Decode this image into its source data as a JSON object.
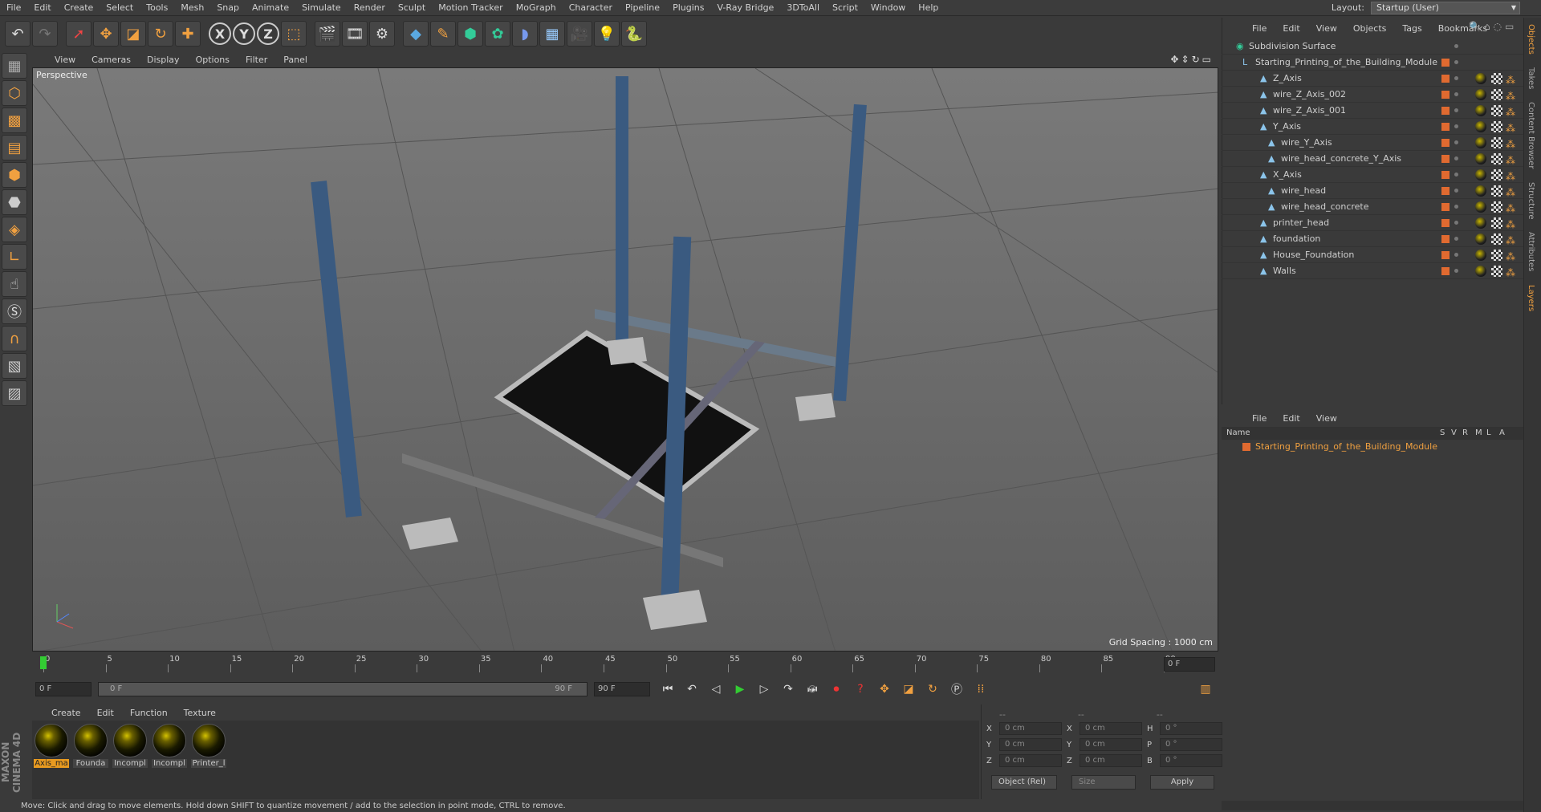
{
  "menubar": [
    "File",
    "Edit",
    "Create",
    "Select",
    "Tools",
    "Mesh",
    "Snap",
    "Animate",
    "Simulate",
    "Render",
    "Sculpt",
    "Motion Tracker",
    "MoGraph",
    "Character",
    "Pipeline",
    "Plugins",
    "V-Ray Bridge",
    "3DToAll",
    "Script",
    "Window",
    "Help"
  ],
  "layout": {
    "label": "Layout:",
    "value": "Startup (User)"
  },
  "viewport": {
    "menu": [
      "View",
      "Cameras",
      "Display",
      "Options",
      "Filter",
      "Panel"
    ],
    "label": "Perspective",
    "grid_spacing": "Grid Spacing : 1000 cm"
  },
  "timeline": {
    "ticks": [
      "0",
      "5",
      "10",
      "15",
      "20",
      "25",
      "30",
      "35",
      "40",
      "45",
      "50",
      "55",
      "60",
      "65",
      "70",
      "75",
      "80",
      "85",
      "90"
    ],
    "end_field": "0 F"
  },
  "time_controls": {
    "start": "0 F",
    "range_start": "0 F",
    "range_end": "90 F",
    "end": "90 F"
  },
  "materials": {
    "menu": [
      "Create",
      "Edit",
      "Function",
      "Texture"
    ],
    "items": [
      "Axis_ma",
      "Founda",
      "Incompl",
      "Incompl",
      "Printer_l"
    ]
  },
  "coords": {
    "header": [
      "--",
      "--",
      "--"
    ],
    "rows": [
      {
        "a": "X",
        "av": "0 cm",
        "b": "X",
        "bv": "0 cm",
        "c": "H",
        "cv": "0 °"
      },
      {
        "a": "Y",
        "av": "0 cm",
        "b": "Y",
        "bv": "0 cm",
        "c": "P",
        "cv": "0 °"
      },
      {
        "a": "Z",
        "av": "0 cm",
        "b": "Z",
        "bv": "0 cm",
        "c": "B",
        "cv": "0 °"
      }
    ],
    "mode": "Object (Rel)",
    "size": "Size",
    "apply": "Apply"
  },
  "status": "Move: Click and drag to move elements. Hold down SHIFT to quantize movement / add to the selection in point mode, CTRL to remove.",
  "objects": {
    "menu": [
      "File",
      "Edit",
      "View",
      "Objects",
      "Tags",
      "Bookmarks"
    ],
    "items": [
      "Subdivision Surface",
      "Starting_Printing_of_the_Building_Module",
      "Z_Axis",
      "wire_Z_Axis_002",
      "wire_Z_Axis_001",
      "Y_Axis",
      "wire_Y_Axis",
      "wire_head_concrete_Y_Axis",
      "X_Axis",
      "wire_head",
      "wire_head_concrete",
      "printer_head",
      "foundation",
      "House_Foundation",
      "Walls"
    ]
  },
  "layers": {
    "menu": [
      "File",
      "Edit",
      "View"
    ],
    "columns": [
      "Name",
      "S",
      "V",
      "R",
      "M",
      "L",
      "A"
    ],
    "row": "Starting_Printing_of_the_Building_Module"
  },
  "right_tabs": [
    "Objects",
    "Takes",
    "Content Browser",
    "Structure",
    "Attributes",
    "Layers"
  ],
  "brand": "MAXON CINEMA 4D"
}
